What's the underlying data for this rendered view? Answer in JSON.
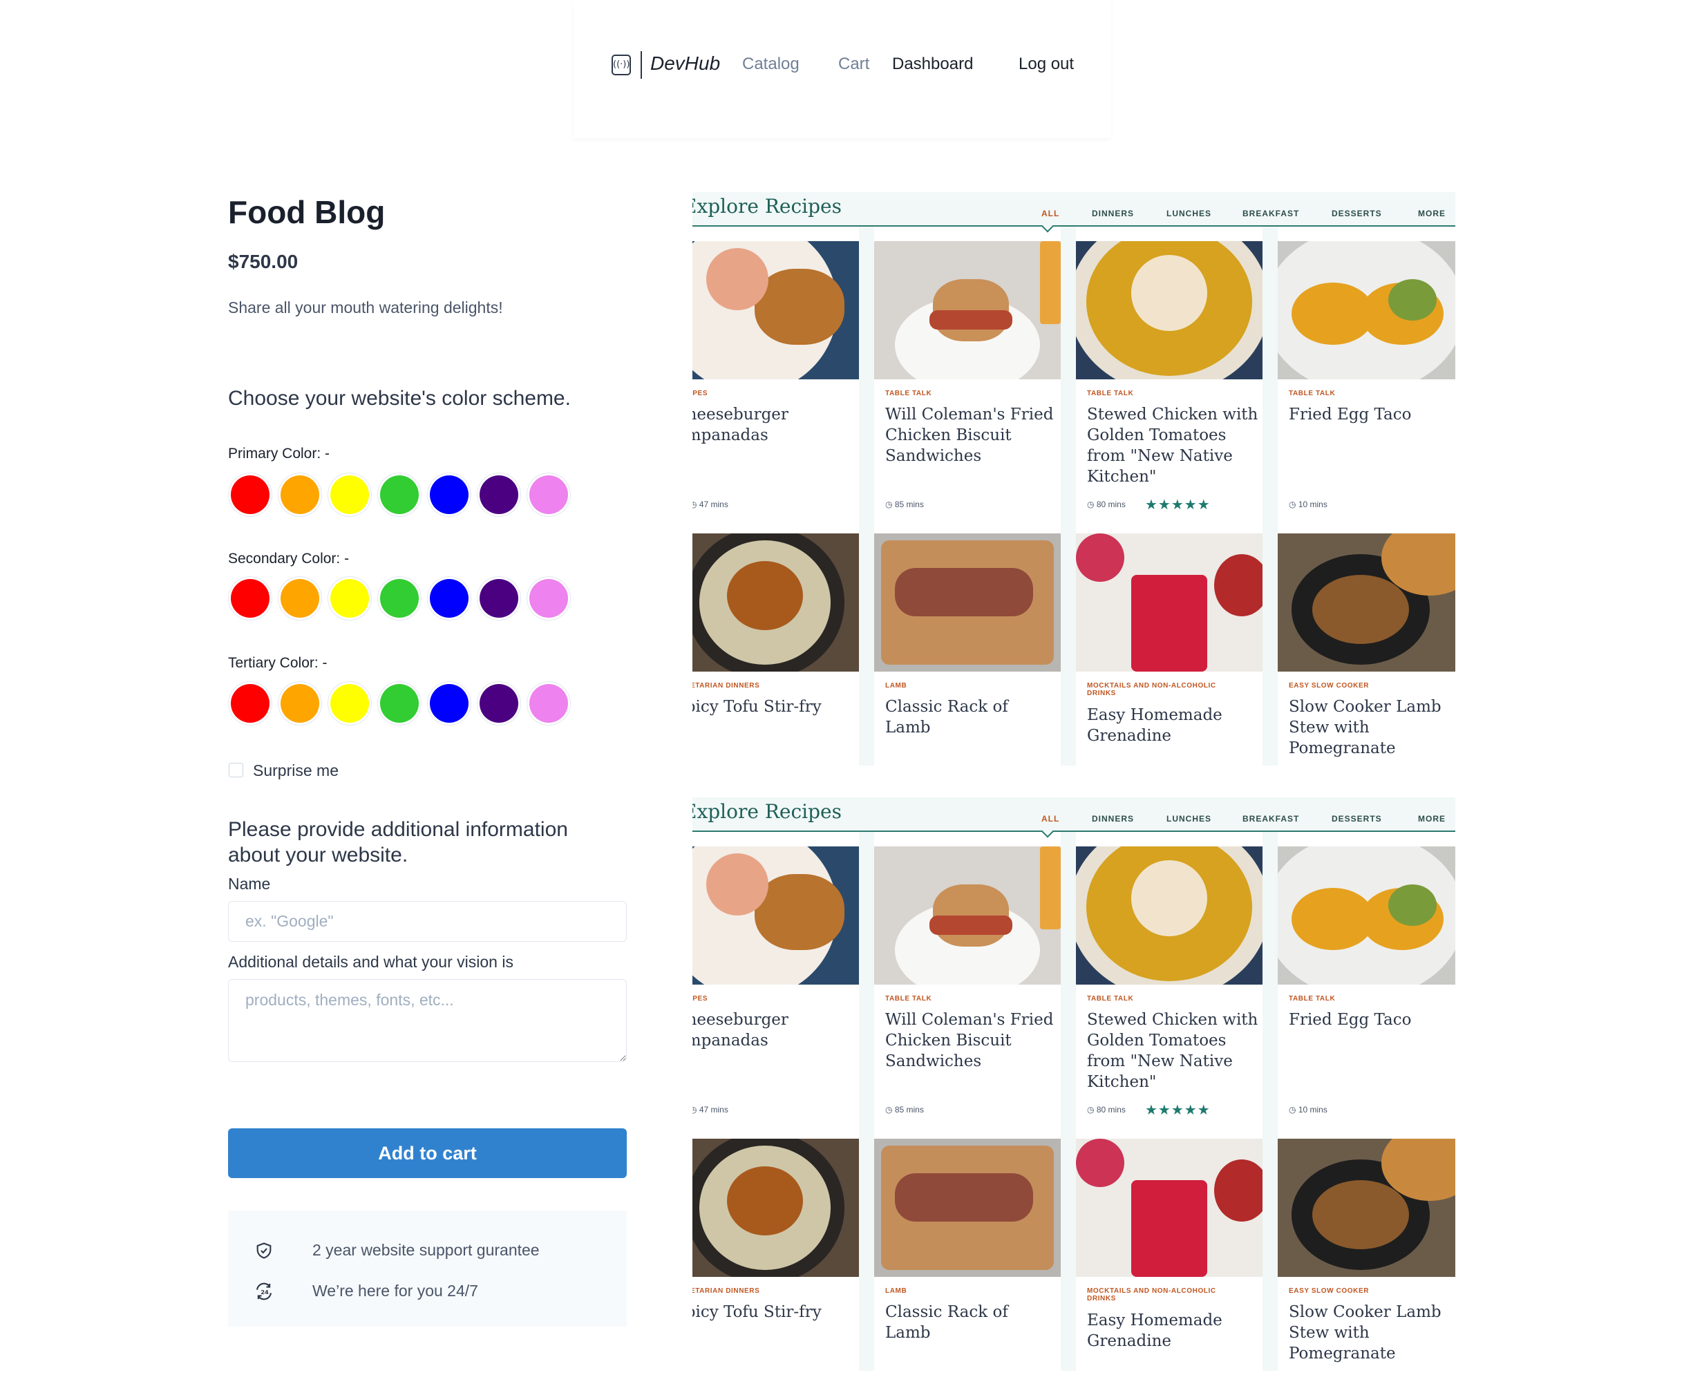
{
  "header": {
    "brand": "DevHub",
    "nav": {
      "catalog": "Catalog",
      "cart": "Cart",
      "dashboard": "Dashboard",
      "logout": "Log out"
    }
  },
  "product": {
    "title": "Food Blog",
    "price": "$750.00",
    "description": "Share all your mouth watering delights!"
  },
  "color_scheme": {
    "heading": "Choose your website's color scheme.",
    "primary_label": "Primary Color: -",
    "secondary_label": "Secondary Color: -",
    "tertiary_label": "Tertiary Color: -",
    "swatches": [
      "#ff0000",
      "#ffa500",
      "#ffff00",
      "#32cd32",
      "#0000ff",
      "#4b0082",
      "#ee82ee"
    ],
    "surprise_label": "Surprise me"
  },
  "info": {
    "heading": "Please provide additional information about your website.",
    "name_label": "Name",
    "name_placeholder": "ex. \"Google\"",
    "details_label": "Additional details and what your vision is",
    "details_placeholder": "products, themes, fonts, etc..."
  },
  "add_to_cart": "Add to cart",
  "perks": {
    "support": "2 year website support gurantee",
    "help": "We’re here for you 24/7"
  },
  "preview": {
    "title": "Explore Recipes",
    "tabs": [
      "ALL",
      "DINNERS",
      "LUNCHES",
      "BREAKFAST",
      "DESSERTS",
      "MORE"
    ],
    "stars": "★★★★★",
    "recipes": [
      {
        "category": "RECIPES",
        "name": "Cheeseburger Empanadas",
        "time": "47 mins"
      },
      {
        "category": "TABLE TALK",
        "name": "Will Coleman's Fried Chicken Biscuit Sandwiches",
        "time": "85 mins"
      },
      {
        "category": "TABLE TALK",
        "name": "Stewed Chicken with Golden Tomatoes from \"New Native Kitchen\"",
        "time": "80 mins"
      },
      {
        "category": "TABLE TALK",
        "name": "Fried Egg Taco",
        "time": "10 mins"
      },
      {
        "category": "VEGETARIAN DINNERS",
        "name": "Spicy Tofu Stir-fry",
        "time": ""
      },
      {
        "category": "LAMB",
        "name": "Classic Rack of Lamb",
        "time": ""
      },
      {
        "category": "MOCKTAILS AND NON-ALCOHOLIC DRINKS",
        "name": "Easy Homemade Grenadine",
        "time": ""
      },
      {
        "category": "EASY SLOW COOKER",
        "name": "Slow Cooker Lamb Stew with Pomegranate",
        "time": ""
      }
    ]
  }
}
